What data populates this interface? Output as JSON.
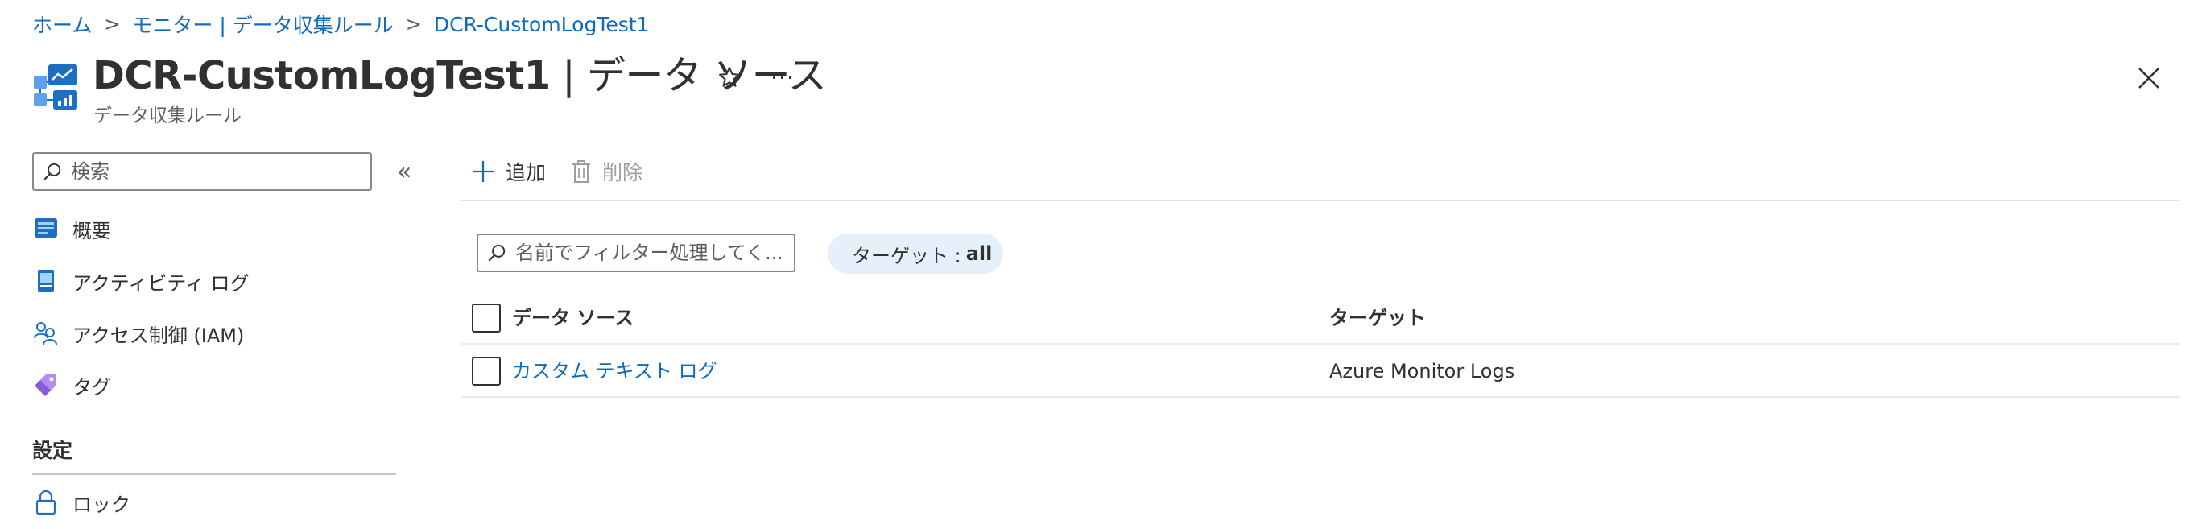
{
  "breadcrumb": {
    "items": [
      "ホーム",
      "モニター | データ収集ルール",
      "DCR-CustomLogTest1"
    ],
    "separator": ">"
  },
  "header": {
    "title_main": "DCR-CustomLogTest1",
    "title_suffix": " | データ ソース",
    "subtitle": "データ収集ルール",
    "more_label": "···"
  },
  "sidebar": {
    "search_placeholder": "検索",
    "collapse_label": "«",
    "items": [
      {
        "label": "概要",
        "icon": "overview-icon"
      },
      {
        "label": "アクティビティ ログ",
        "icon": "activity-log-icon"
      },
      {
        "label": "アクセス制御 (IAM)",
        "icon": "iam-icon"
      },
      {
        "label": "タグ",
        "icon": "tag-icon"
      }
    ],
    "section_title": "設定",
    "settings_items": [
      {
        "label": "ロック",
        "icon": "lock-icon"
      }
    ]
  },
  "toolbar": {
    "add_label": "追加",
    "delete_label": "削除"
  },
  "filter": {
    "placeholder": "名前でフィルター処理してく...",
    "pill_key": "ターゲット : ",
    "pill_value": "all"
  },
  "table": {
    "columns": [
      "データ ソース",
      "ターゲット"
    ],
    "rows": [
      {
        "source": "カスタム テキスト ログ",
        "target": "Azure Monitor Logs"
      }
    ]
  },
  "colors": {
    "link": "#0f6cbd",
    "pill_bg": "#e6f0fa",
    "text": "#323130"
  }
}
